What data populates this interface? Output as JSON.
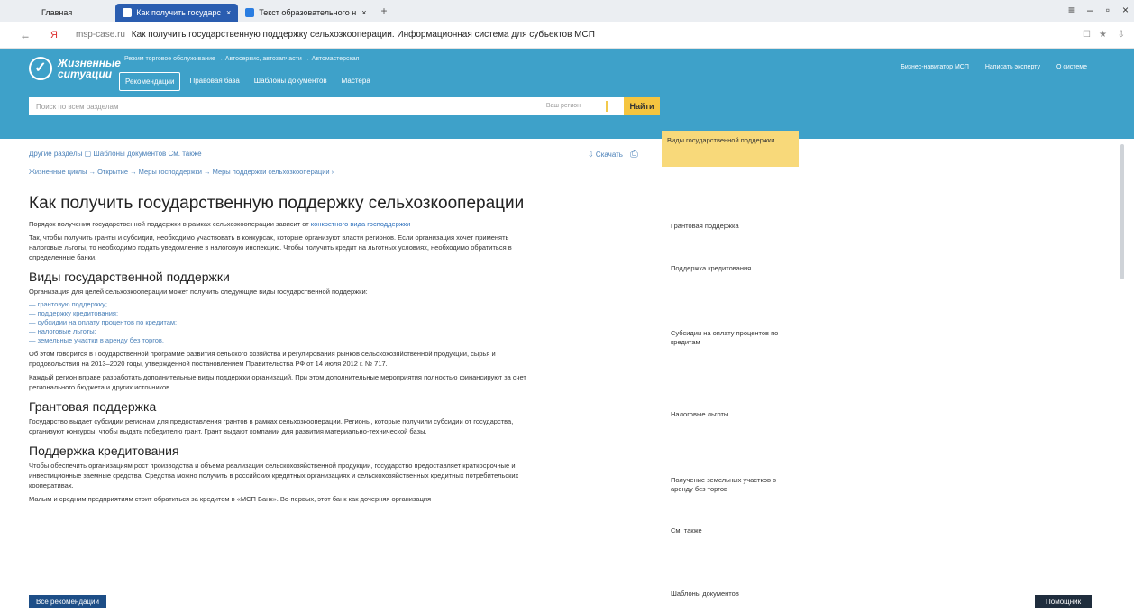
{
  "browser": {
    "tabs": [
      {
        "label": "Главная"
      },
      {
        "label": "Как получить государс"
      },
      {
        "label": "Текст образовательного н"
      }
    ],
    "new_tab": "+",
    "url_domain": "msp-case.ru",
    "url_title": "Как получить государственную поддержку сельхозкооперации. Информационная система для субъектов МСП"
  },
  "site": {
    "logo_line1": "Жизненные",
    "logo_line2": "ситуации",
    "mini_breadcrumb": "Режим торговое обслуживание → Автосервис, автозапчасти → Автомастерская",
    "nav": [
      "Рекомендации",
      "Правовая база",
      "Шаблоны документов",
      "Мастера"
    ],
    "top_links": [
      "Бизнес-навигатор МСП",
      "Написать эксперту",
      "О системе"
    ],
    "search_placeholder": "Поиск по всем разделам",
    "search_region": "Ваш регион",
    "find_label": "Найти"
  },
  "page": {
    "subnav": "Другие разделы ▢ Шаблоны документов См. также",
    "crumbs": "Жизненные циклы → Открытие → Меры господдержки → Меры поддержки сельхозкооперации ›",
    "download": "⇩ Скачать",
    "title": "Как получить государственную поддержку сельхозкооперации",
    "intro1_pre": "Порядок получения государственной поддержки в рамках сельхозкооперации зависит от ",
    "intro1_link": "конкретного вида господдержки",
    "intro2": "Так, чтобы получить гранты и субсидии, необходимо участвовать в конкурсах, которые организуют власти регионов. Если организация хочет применять налоговые льготы, то необходимо подать уведомление в налоговую инспекцию. Чтобы получить кредит на льготных условиях, необходимо обратиться в определенные банки.",
    "h_types": "Виды государственной поддержки",
    "types_intro": "Организация для целей сельхозкооперации может получить следующие виды государственной поддержки:",
    "types": [
      "— грантовую поддержку;",
      "— поддержку кредитования;",
      "— субсидии на оплату процентов по кредитам;",
      "— налоговые льготы;",
      "— земельные участки в аренду без торгов."
    ],
    "program_text": "Об этом говорится в Государственной программе развития сельского хозяйства и регулирования рынков сельскохозяйственной продукции, сырья и продовольствия на 2013–2020 годы, утвержденной постановлением Правительства РФ от 14 июля 2012 г. № 717.",
    "regions_text": "Каждый регион вправе разработать дополнительные виды поддержки организаций. При этом дополнительные мероприятия полностью финансируют за счет регионального бюджета и других источников.",
    "h_grant": "Грантовая поддержка",
    "grant_text": "Государство выдает субсидии регионам для предоставления грантов в рамках сельхозкооперации. Регионы, которые получили субсидии от государства, организуют конкурсы, чтобы выдать победителю грант. Грант выдают компании для развития материально-технической базы.",
    "h_credit": "Поддержка кредитования",
    "credit_text": "Чтобы обеспечить организациям рост производства и объема реализации сельскохозяйственной продукции, государство предоставляет краткосрочные и инвестиционные заемные средства. Средства можно получить в российских кредитных организациях и сельскохозяйственных кредитных потребительских кооперативах.",
    "credit_text2": "Малым и средним предприятиям стоит обратиться за кредитом в «МСП Банк». Во-первых, этот банк как дочерняя организация"
  },
  "toc": {
    "active": "Виды государственной поддержки",
    "items": [
      "Грантовая поддержка",
      "Поддержка кредитования",
      "Субсидии на оплату процентов по кредитам",
      "Налоговые льготы",
      "Получение земельных участков в аренду без торгов",
      "См. также",
      "Шаблоны документов"
    ]
  },
  "footer": {
    "all_recs": "Все рекомендации",
    "help": "Помощник"
  }
}
